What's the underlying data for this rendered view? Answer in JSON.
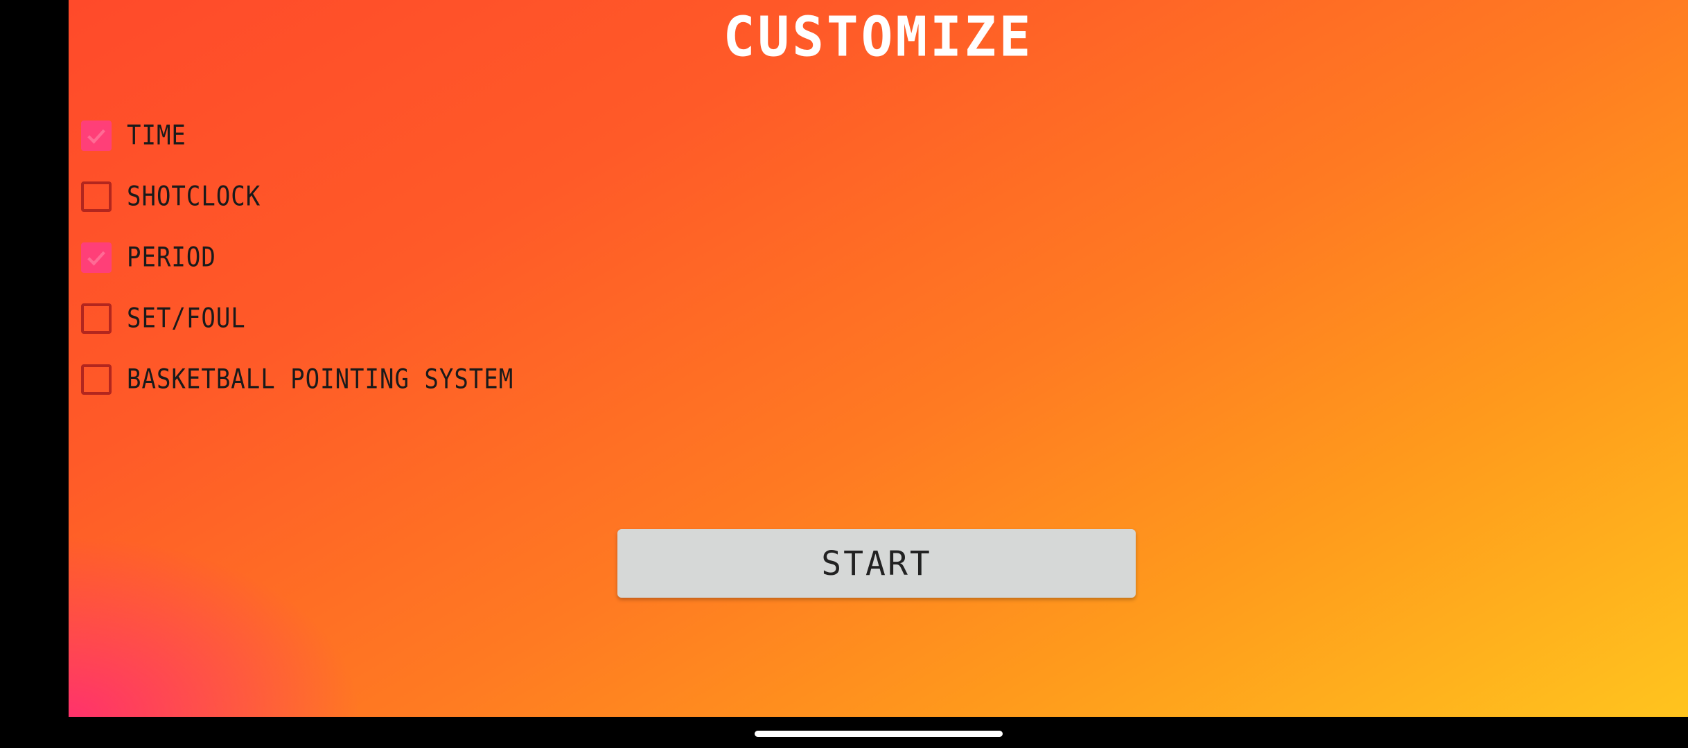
{
  "title": "CUSTOMIZE",
  "options": [
    {
      "label": "TIME",
      "checked": true
    },
    {
      "label": "SHOTCLOCK",
      "checked": false
    },
    {
      "label": "PERIOD",
      "checked": true
    },
    {
      "label": "SET/FOUL",
      "checked": false
    },
    {
      "label": "BASKETBALL POINTING SYSTEM",
      "checked": false
    }
  ],
  "start_label": "START",
  "colors": {
    "checkbox_checked": "#ff3f78",
    "checkbox_border": "#b3261e",
    "button_bg": "#d6d8d7"
  }
}
